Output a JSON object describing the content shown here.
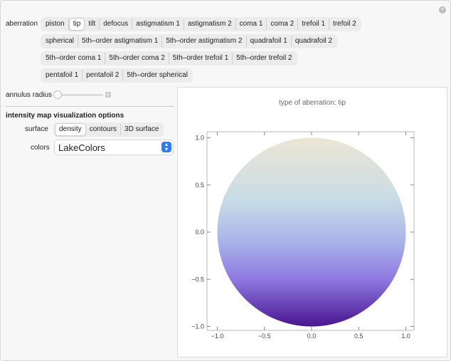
{
  "aberration": {
    "label": "aberration",
    "selected": "tip",
    "rows": [
      [
        "piston",
        "tip",
        "tilt",
        "defocus",
        "astigmatism 1",
        "astigmatism 2",
        "coma 1",
        "coma 2",
        "trefoil 1",
        "trefoil 2"
      ],
      [
        "spherical",
        "5th–order astigmatism 1",
        "5th–order astigmatism 2",
        "quadrafoil 1",
        "quadrafoil 2"
      ],
      [
        "5th–order coma 1",
        "5th–order coma 2",
        "5th–order trefoil 1",
        "5th–order trefoil 2"
      ],
      [
        "pentafoil 1",
        "pentafoil 2",
        "5th–order spherical"
      ]
    ]
  },
  "annulus": {
    "label": "annulus radius",
    "value": 0
  },
  "options": {
    "heading": "intensity map visualization options",
    "surface_label": "surface",
    "surface": [
      "density",
      "contours",
      "3D surface"
    ],
    "surface_selected": "density",
    "colors_label": "colors",
    "colors_value": "LakeColors"
  },
  "chart_data": {
    "type": "heatmap",
    "title": "type of aberration: tip",
    "xlim": [
      -1,
      1
    ],
    "ylim": [
      -1,
      1
    ],
    "xticks": [
      "−1.0",
      "−0.5",
      "0.0",
      "0.5",
      "1.0"
    ],
    "yticks": [
      "1.0",
      "0.5",
      "0.0",
      "−0.5",
      "−1.0"
    ],
    "colormap": "LakeColors",
    "shape": "unit disk",
    "gradient_direction": "vertical",
    "colors": [
      "#ece5d5",
      "#c8dce6",
      "#aab3ea",
      "#8e79e0",
      "#4a1590"
    ]
  }
}
